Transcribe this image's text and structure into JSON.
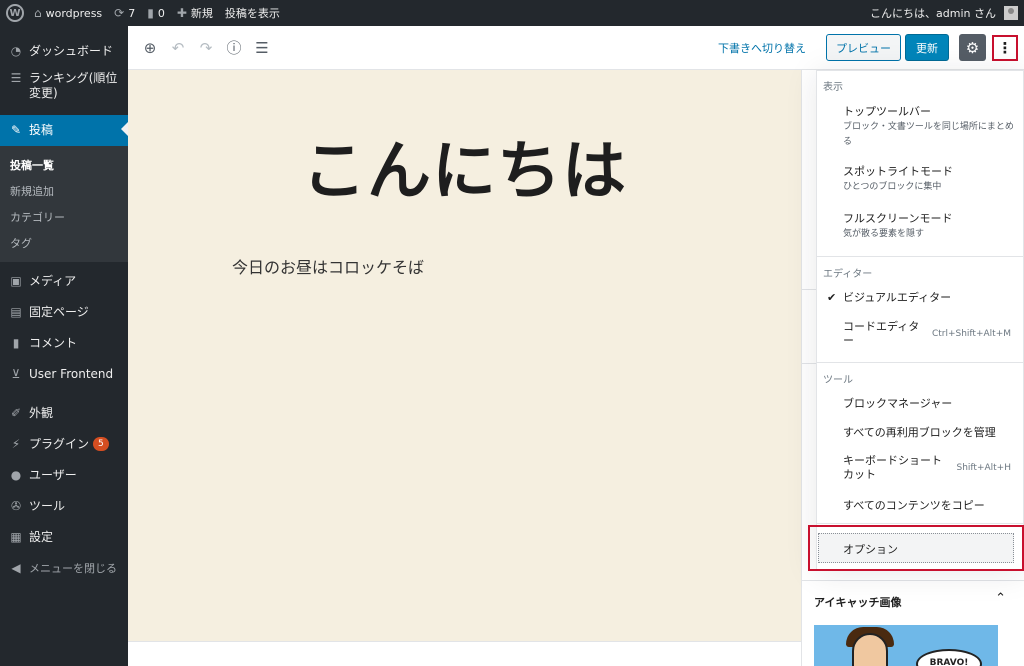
{
  "adminbar": {
    "site_name": "wordpress",
    "updates_count": "7",
    "comments_count": "0",
    "new_label": "新規",
    "view_post": "投稿を表示",
    "greeting": "こんにちは、admin さん"
  },
  "sidebar": {
    "dashboard": "ダッシュボード",
    "ranking": "ランキング(順位変更)",
    "posts": "投稿",
    "sub": [
      "投稿一覧",
      "新規追加",
      "カテゴリー",
      "タグ"
    ],
    "media": "メディア",
    "pages": "固定ページ",
    "comments": "コメント",
    "user_frontend": "User Frontend",
    "appearance": "外観",
    "plugins": "プラグイン",
    "plugins_badge": "5",
    "users": "ユーザー",
    "tools": "ツール",
    "settings": "設定",
    "collapse": "メニューを閉じる"
  },
  "toolbar": {
    "switch_to_draft": "下書きへ切り替え",
    "preview": "プレビュー",
    "update": "更新"
  },
  "post": {
    "title": "こんにちは",
    "paragraph": "今日のお昼はコロッケそば"
  },
  "settings_sidebar": {
    "featured_image_title": "アイキャッチ画像",
    "featured_image_text": "BRAVO!"
  },
  "more_menu": {
    "view_label": "表示",
    "top_toolbar": "トップツールバー",
    "top_toolbar_desc": "ブロック・文書ツールを同じ場所にまとめる",
    "spotlight": "スポットライトモード",
    "spotlight_desc": "ひとつのブロックに集中",
    "fullscreen": "フルスクリーンモード",
    "fullscreen_desc": "気が散る要素を隠す",
    "editor_label": "エディター",
    "visual_editor": "ビジュアルエディター",
    "code_editor": "コードエディター",
    "code_editor_shortcut": "Ctrl+Shift+Alt+M",
    "tools_label": "ツール",
    "block_manager": "ブロックマネージャー",
    "manage_reusable": "すべての再利用ブロックを管理",
    "keyboard_shortcuts": "キーボードショートカット",
    "keyboard_shortcuts_shortcut": "Shift+Alt+H",
    "copy_all": "すべてのコンテンツをコピー",
    "options": "オプション"
  },
  "colors": {
    "admin_dark": "#23282d",
    "active_blue": "#0073aa",
    "canvas_bg": "#f5efe0",
    "highlight_red": "#c8102e"
  }
}
